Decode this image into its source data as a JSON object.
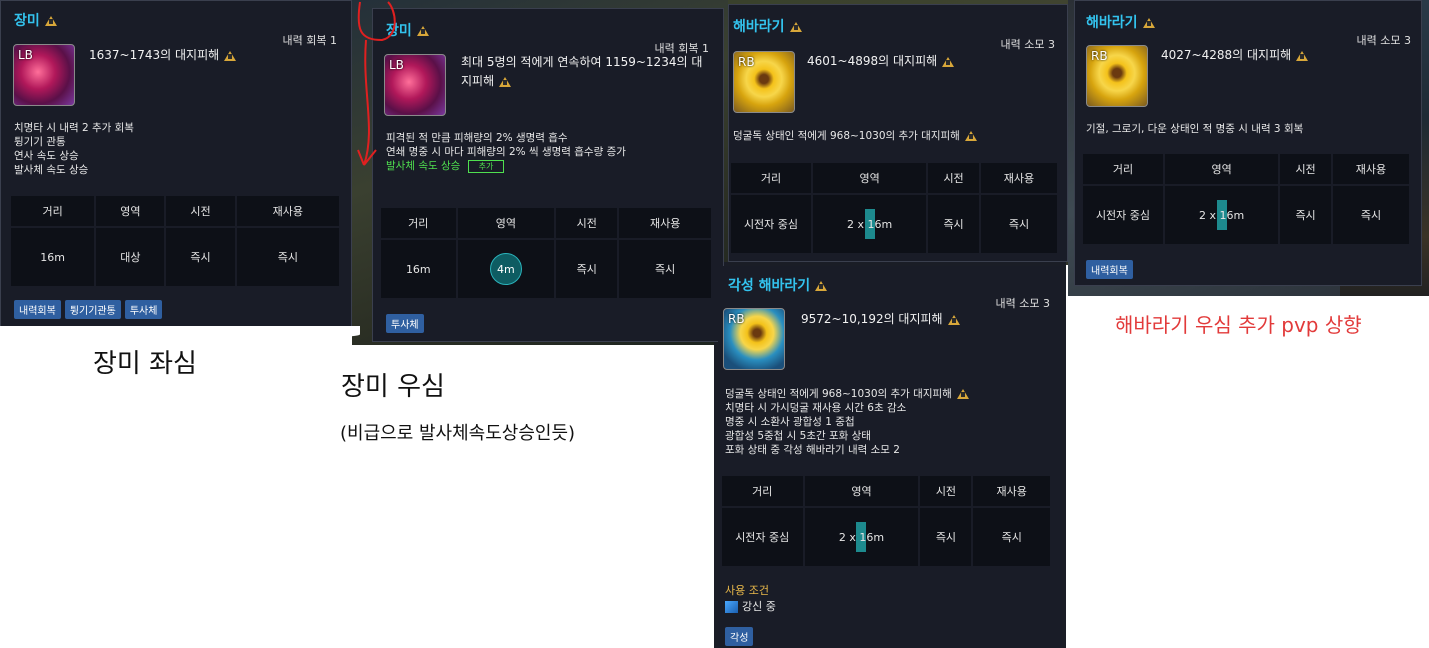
{
  "colors": {
    "title": "#33c3ee",
    "added": "#4fe04f",
    "note_red": "#e23a3a",
    "tag_bg": "#2f5fa0",
    "cond": "#e8b84a"
  },
  "tooltips": {
    "rose_left": {
      "title": "장미",
      "resource": "내력 회복 1",
      "key": "LB",
      "damage": "1637~1743의 대지피해",
      "effects": [
        "치명타 시 내력 2 추가 회복",
        "튕기기 관통",
        "연사 속도 상승",
        "발사체 속도 상승"
      ],
      "headers": [
        "거리",
        "영역",
        "시전",
        "재사용"
      ],
      "values": [
        "16m",
        "대상",
        "즉시",
        "즉시"
      ],
      "tags": [
        "내력회복",
        "튕기기관통",
        "투사체"
      ]
    },
    "rose_right": {
      "title": "장미",
      "resource": "내력 회복 1",
      "key": "LB",
      "damage": "최대 5명의 적에게 연속하여 1159~1234의 대지피해",
      "effects": [
        "피격된 적 만큼 피해량의 2% 생명력 흡수",
        "연쇄 명중 시 마다 피해량의 2% 씩 생명력 흡수량 증가"
      ],
      "added_effect": "발사체 속도 상승",
      "added_badge": "추가",
      "headers": [
        "거리",
        "영역",
        "시전",
        "재사용"
      ],
      "values": [
        "16m",
        "4m",
        "즉시",
        "즉시"
      ],
      "tags": [
        "투사체"
      ]
    },
    "sunflower_mid": {
      "title": "해바라기",
      "resource": "내력 소모 3",
      "key": "RB",
      "damage": "4601~4898의 대지피해",
      "effects": [
        "덩굴독 상태인 적에게 968~1030의 추가 대지피해"
      ],
      "headers": [
        "거리",
        "영역",
        "시전",
        "재사용"
      ],
      "values": [
        "시전자 중심",
        "2 x 16m",
        "즉시",
        "즉시"
      ]
    },
    "sunflower_right": {
      "title": "해바라기",
      "resource": "내력 소모 3",
      "key": "RB",
      "damage": "4027~4288의 대지피해",
      "effects": [
        "기절, 그로기, 다운 상태인 적 명중 시 내력 3 회복"
      ],
      "headers": [
        "거리",
        "영역",
        "시전",
        "재사용"
      ],
      "values": [
        "시전자 중심",
        "2 x 16m",
        "즉시",
        "즉시"
      ],
      "tags": [
        "내력회복"
      ]
    },
    "awakened": {
      "title": "각성 해바라기",
      "resource": "내력 소모 3",
      "key": "RB",
      "damage": "9572~10,192의 대지피해",
      "effects": [
        "덩굴독 상태인 적에게 968~1030의 추가 대지피해",
        "치명타 시 가시덩굴 재사용 시간 6초 감소",
        "명중 시 소환사 광합성 1 중첩",
        "광합성 5중첩 시 5초간 포화 상태",
        "포화 상태 중 각성 해바라기 내력 소모 2"
      ],
      "headers": [
        "거리",
        "영역",
        "시전",
        "재사용"
      ],
      "values": [
        "시전자 중심",
        "2 x 16m",
        "즉시",
        "즉시"
      ],
      "condition_label": "사용 조건",
      "condition_value": "강신 중",
      "tags": [
        "각성"
      ]
    }
  },
  "notes": {
    "rose_left": "장미 좌심",
    "rose_right": "장미 우심",
    "rose_right_sub": "(비급으로 발사체속도상승인듯)",
    "sunflower": "해바라기 우심 추가 pvp 상향"
  }
}
